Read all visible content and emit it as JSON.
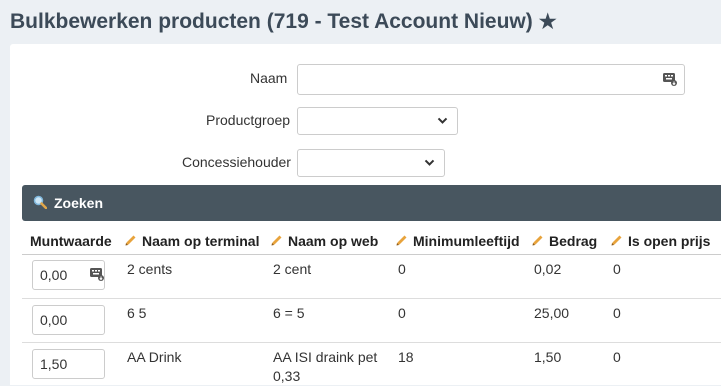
{
  "page": {
    "title": "Bulkbewerken producten (719 - Test Account Nieuw)"
  },
  "filters": {
    "naam_label": "Naam",
    "naam_value": "",
    "productgroep_label": "Productgroep",
    "productgroep_value": "",
    "concessiehouder_label": "Concessiehouder",
    "concessiehouder_value": ""
  },
  "search": {
    "button_label": "Zoeken"
  },
  "table": {
    "headers": [
      "Muntwaarde",
      "Naam op terminal",
      "Naam op web",
      "Minimumleeftijd",
      "Bedrag",
      "Is open prijs"
    ],
    "rows": [
      {
        "muntwaarde": "0,00",
        "terminal": "2 cents",
        "web": "2 cent",
        "web2": "",
        "minleeftijd": "0",
        "bedrag": "0,02",
        "open": "0"
      },
      {
        "muntwaarde": "0,00",
        "terminal": "6 5",
        "web": "6 = 5",
        "web2": "",
        "minleeftijd": "0",
        "bedrag": "25,00",
        "open": "0"
      },
      {
        "muntwaarde": "1,50",
        "terminal": "AA Drink",
        "web": "AA ISI draink pet",
        "web2": "0,33",
        "minleeftijd": "18",
        "bedrag": "1,50",
        "open": "0"
      }
    ]
  },
  "colors": {
    "header_bg": "#485660",
    "title": "#3c4a58",
    "pencil": "#e8a33c"
  },
  "icons": {
    "favorite": "star-icon",
    "search": "magnifier-icon",
    "edit": "pencil-icon",
    "keyboard": "keyboard-icon",
    "select": "chevron-down-icon"
  }
}
